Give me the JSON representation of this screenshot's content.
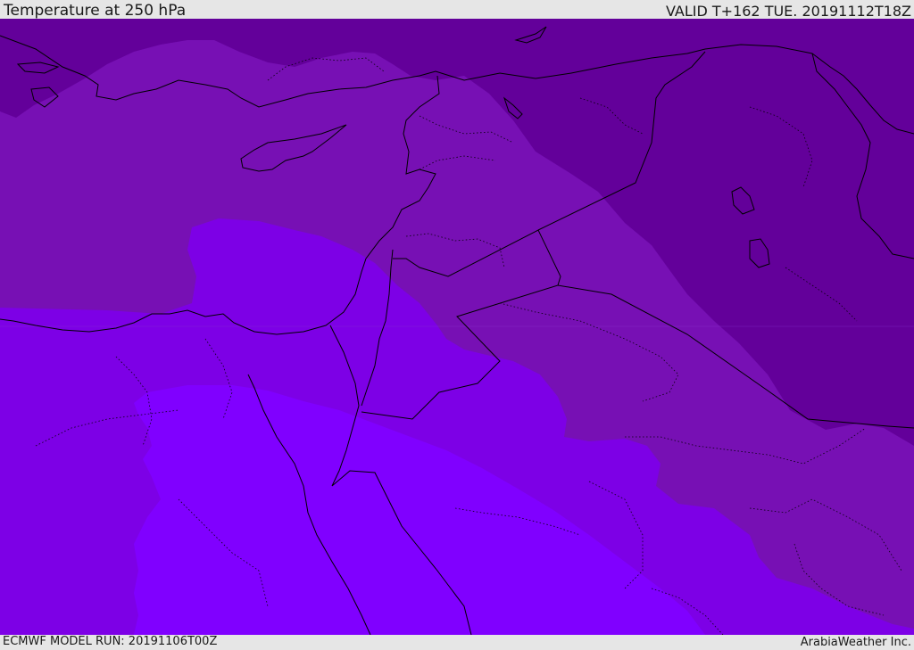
{
  "header": {
    "title": "Temperature at 250 hPa",
    "valid_time": "VALID T+162 TUE. 20191112T18Z"
  },
  "footer": {
    "model_run": "ECMWF MODEL RUN: 20191106T00Z",
    "credit": "ArabiaWeather Inc."
  },
  "map": {
    "region": "Eastern Mediterranean / Middle East",
    "field": "temperature",
    "colors": {
      "coldest": "#63009a",
      "cold": "#7710b4",
      "mid": "#7d00e6",
      "warmest": "#8000ff",
      "border": "#000000"
    }
  }
}
